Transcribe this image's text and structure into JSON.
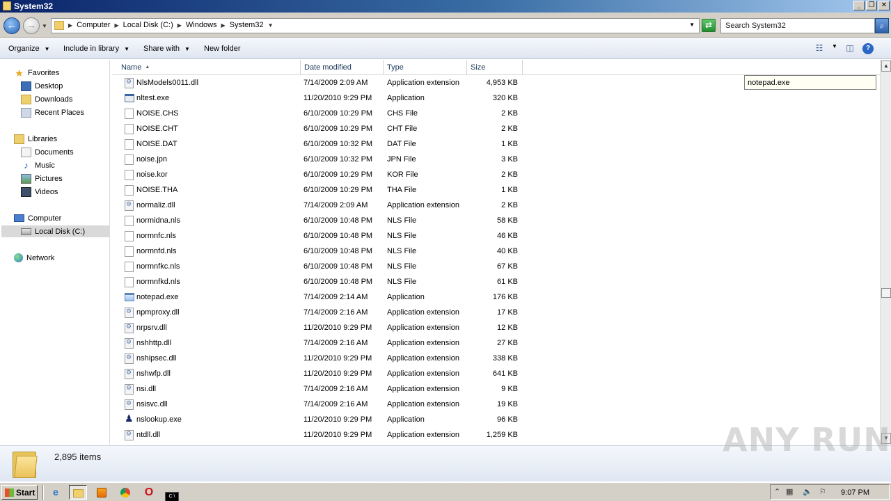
{
  "window": {
    "title": "System32"
  },
  "address": {
    "crumbs": [
      "Computer",
      "Local Disk (C:)",
      "Windows",
      "System32"
    ],
    "search_placeholder": "Search System32"
  },
  "toolbar": {
    "organize": "Organize",
    "include_in_library": "Include in library",
    "share_with": "Share with",
    "new_folder": "New folder",
    "help": "?"
  },
  "nav": {
    "favorites": "Favorites",
    "desktop": "Desktop",
    "downloads": "Downloads",
    "recent_places": "Recent Places",
    "libraries": "Libraries",
    "documents": "Documents",
    "music": "Music",
    "pictures": "Pictures",
    "videos": "Videos",
    "computer": "Computer",
    "local_disk": "Local Disk (C:)",
    "network": "Network"
  },
  "columns": {
    "name": "Name",
    "date": "Date modified",
    "type": "Type",
    "size": "Size"
  },
  "files": [
    {
      "name": "NlsModels0011.dll",
      "date": "7/14/2009 2:09 AM",
      "type": "Application extension",
      "size": "4,953 KB",
      "icon": "dll"
    },
    {
      "name": "nltest.exe",
      "date": "11/20/2010 9:29 PM",
      "type": "Application",
      "size": "320 KB",
      "icon": "exe"
    },
    {
      "name": "NOISE.CHS",
      "date": "6/10/2009 10:29 PM",
      "type": "CHS File",
      "size": "2 KB",
      "icon": "file"
    },
    {
      "name": "NOISE.CHT",
      "date": "6/10/2009 10:29 PM",
      "type": "CHT File",
      "size": "2 KB",
      "icon": "file"
    },
    {
      "name": "NOISE.DAT",
      "date": "6/10/2009 10:32 PM",
      "type": "DAT File",
      "size": "1 KB",
      "icon": "file"
    },
    {
      "name": "noise.jpn",
      "date": "6/10/2009 10:32 PM",
      "type": "JPN File",
      "size": "3 KB",
      "icon": "file"
    },
    {
      "name": "noise.kor",
      "date": "6/10/2009 10:29 PM",
      "type": "KOR File",
      "size": "2 KB",
      "icon": "file"
    },
    {
      "name": "NOISE.THA",
      "date": "6/10/2009 10:29 PM",
      "type": "THA File",
      "size": "1 KB",
      "icon": "file"
    },
    {
      "name": "normaliz.dll",
      "date": "7/14/2009 2:09 AM",
      "type": "Application extension",
      "size": "2 KB",
      "icon": "dll"
    },
    {
      "name": "normidna.nls",
      "date": "6/10/2009 10:48 PM",
      "type": "NLS File",
      "size": "58 KB",
      "icon": "file"
    },
    {
      "name": "normnfc.nls",
      "date": "6/10/2009 10:48 PM",
      "type": "NLS File",
      "size": "46 KB",
      "icon": "file"
    },
    {
      "name": "normnfd.nls",
      "date": "6/10/2009 10:48 PM",
      "type": "NLS File",
      "size": "40 KB",
      "icon": "file"
    },
    {
      "name": "normnfkc.nls",
      "date": "6/10/2009 10:48 PM",
      "type": "NLS File",
      "size": "67 KB",
      "icon": "file"
    },
    {
      "name": "normnfkd.nls",
      "date": "6/10/2009 10:48 PM",
      "type": "NLS File",
      "size": "61 KB",
      "icon": "file"
    },
    {
      "name": "notepad.exe",
      "date": "7/14/2009 2:14 AM",
      "type": "Application",
      "size": "176 KB",
      "icon": "notepad"
    },
    {
      "name": "npmproxy.dll",
      "date": "7/14/2009 2:16 AM",
      "type": "Application extension",
      "size": "17 KB",
      "icon": "dll"
    },
    {
      "name": "nrpsrv.dll",
      "date": "11/20/2010 9:29 PM",
      "type": "Application extension",
      "size": "12 KB",
      "icon": "dll"
    },
    {
      "name": "nshhttp.dll",
      "date": "7/14/2009 2:16 AM",
      "type": "Application extension",
      "size": "27 KB",
      "icon": "dll"
    },
    {
      "name": "nshipsec.dll",
      "date": "11/20/2010 9:29 PM",
      "type": "Application extension",
      "size": "338 KB",
      "icon": "dll"
    },
    {
      "name": "nshwfp.dll",
      "date": "11/20/2010 9:29 PM",
      "type": "Application extension",
      "size": "641 KB",
      "icon": "dll"
    },
    {
      "name": "nsi.dll",
      "date": "7/14/2009 2:16 AM",
      "type": "Application extension",
      "size": "9 KB",
      "icon": "dll"
    },
    {
      "name": "nsisvc.dll",
      "date": "7/14/2009 2:16 AM",
      "type": "Application extension",
      "size": "19 KB",
      "icon": "dll"
    },
    {
      "name": "nslookup.exe",
      "date": "11/20/2010 9:29 PM",
      "type": "Application",
      "size": "96 KB",
      "icon": "nslookup"
    },
    {
      "name": "ntdll.dll",
      "date": "11/20/2010 9:29 PM",
      "type": "Application extension",
      "size": "1,259 KB",
      "icon": "dll"
    }
  ],
  "rename_box": "notepad.exe",
  "details": {
    "item_count": "2,895 items"
  },
  "watermark": "ANY RUN",
  "taskbar": {
    "start": "Start",
    "clock": "9:07 PM"
  },
  "colors": {
    "title_start": "#0a246a",
    "title_end": "#a6caf0",
    "selection": "#d9d9d9"
  }
}
